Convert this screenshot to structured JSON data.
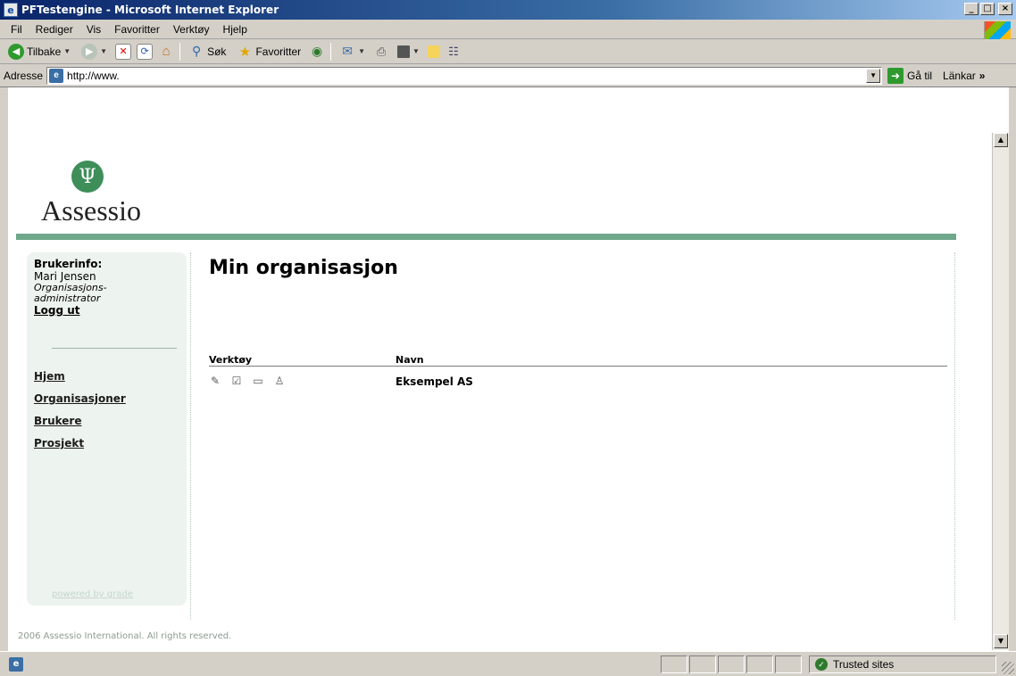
{
  "window": {
    "title": "PFTestengine - Microsoft Internet Explorer",
    "buttons": {
      "minimize": "_",
      "maximize": "□",
      "close": "×"
    }
  },
  "menubar": {
    "items": [
      "Fil",
      "Rediger",
      "Vis",
      "Favoritter",
      "Verktøy",
      "Hjelp"
    ]
  },
  "toolbar": {
    "back_label": "Tilbake",
    "search_label": "Søk",
    "favorites_label": "Favoritter"
  },
  "addressbar": {
    "label": "Adresse",
    "url": "http://www.",
    "go_label": "Gå til",
    "links_label": "Länkar",
    "links_chevron": "»"
  },
  "brand": {
    "name": "Assessio",
    "accent": "#6fa88a",
    "sidebar_bg": "#edf3ef"
  },
  "userinfo": {
    "heading": "Brukerinfo:",
    "name": "Mari Jensen",
    "role_line1": "Organisasjons-",
    "role_line2": "administrator",
    "logout": "Logg ut"
  },
  "nav": {
    "items": [
      "Hjem",
      "Organisasjoner",
      "Brukere",
      "Prosjekt"
    ]
  },
  "powered_by": "powered by grade",
  "main": {
    "title": "Min organisasjon",
    "columns": {
      "tools": "Verktøy",
      "name": "Navn"
    },
    "rows": [
      {
        "name": "Eksempel AS",
        "icons": [
          "edit-icon",
          "checkbox-icon",
          "folder-icon",
          "user-icon"
        ]
      }
    ]
  },
  "footer": {
    "copyright": "2006 Assessio International. All rights reserved."
  },
  "statusbar": {
    "zone": "Trusted sites"
  }
}
